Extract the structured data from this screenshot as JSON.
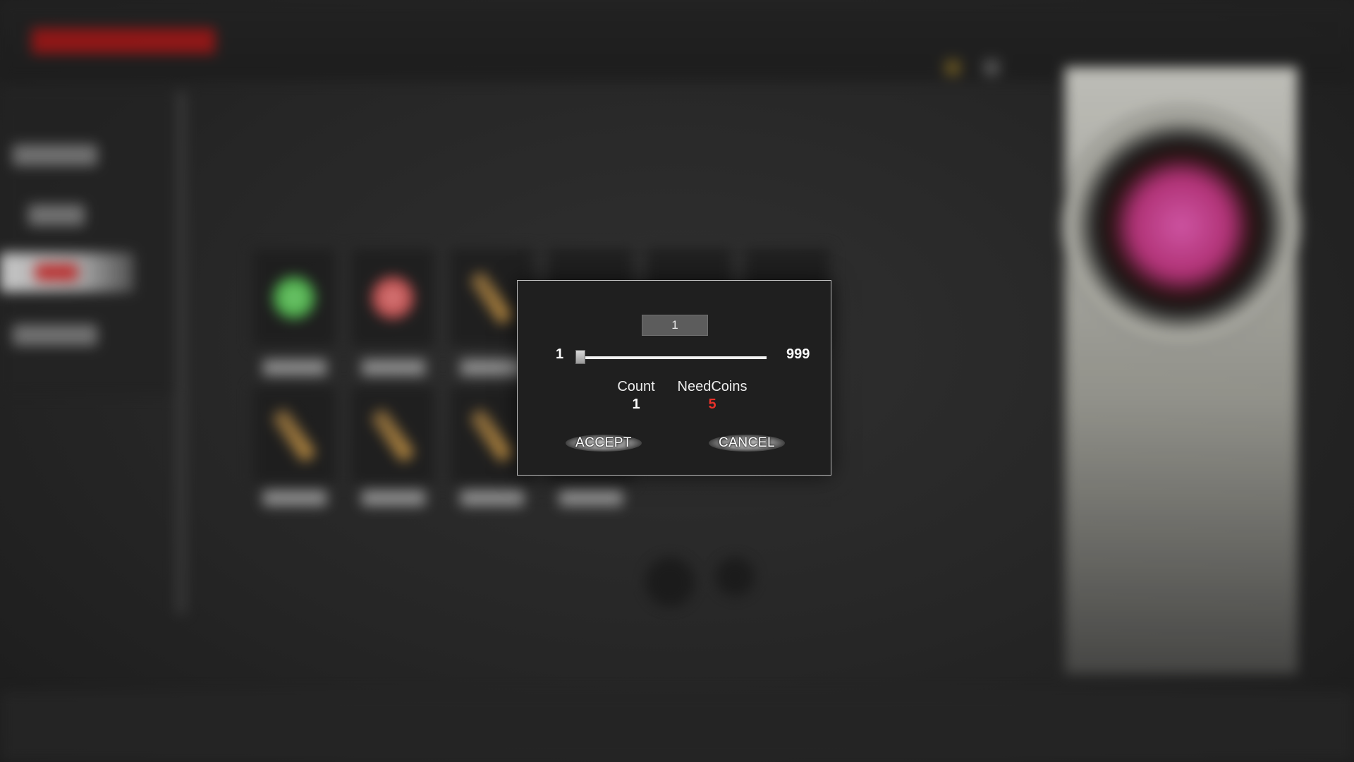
{
  "dialog": {
    "quantity_input": {
      "value": "1"
    },
    "slider": {
      "min_label": "1",
      "max_label": "999",
      "min": 1,
      "max": 999,
      "value": 1
    },
    "count": {
      "label": "Count",
      "value": "1"
    },
    "need_coins": {
      "label": "NeedCoins",
      "value": "5",
      "color": "#e8322a"
    },
    "accept_label": "ACCEPT",
    "cancel_label": "CANCEL",
    "count_value_color": "#ffffff"
  },
  "background": {
    "title_color": "#c01a1a",
    "icons": [
      "green-orb-icon",
      "red-orb-icon",
      "hammer-icon",
      "pickaxe-icon",
      "axe-icon",
      "sword-icon"
    ]
  }
}
